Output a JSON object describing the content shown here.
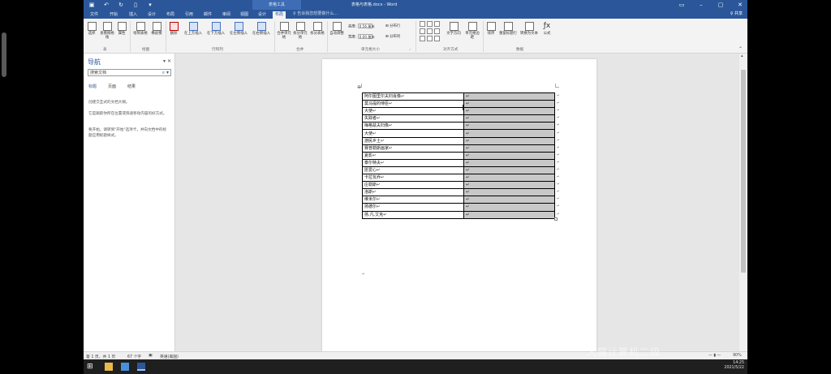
{
  "titlebar": {
    "context_tools": "表格工具",
    "doc_title": "表格与表格.docx - Word",
    "qat_icons": [
      "save-icon",
      "undo-icon",
      "redo-icon",
      "new-doc-icon",
      "customize-icon"
    ]
  },
  "tabs": [
    "文件",
    "开始",
    "插入",
    "设计",
    "布局",
    "引用",
    "邮件",
    "审阅",
    "视图",
    "设计",
    "布局"
  ],
  "active_tab_index": 10,
  "tellme": "♀ 告诉我您想要做什么...",
  "share": "♀ 共享",
  "ribbon": {
    "buttons": {
      "select": "选择",
      "gridlines": "查看网格线",
      "properties": "属性",
      "draw_table": "绘制表格",
      "eraser": "橡皮擦",
      "delete": "删除",
      "insert_above": "在上方插入",
      "insert_below": "在下方插入",
      "insert_left": "在左侧插入",
      "insert_right": "在右侧插入",
      "merge_cells": "合并单元格",
      "split_cells": "拆分单元格",
      "split_table": "拆分表格",
      "autofit": "自动调整",
      "text_direction": "文字方向",
      "cell_margins": "单元格边距",
      "sort": "排序",
      "repeat_header": "重复标题行",
      "to_text": "转换为文本",
      "formula": "公式"
    },
    "height_label": "高度:",
    "height_value": "0.56 厘米",
    "width_label": "宽度:",
    "width_value": "0.00 厘米",
    "distribute_rows": "分布行",
    "distribute_cols": "分布列",
    "groups": {
      "table": "表",
      "draw": "绘图",
      "rows_cols": "行和列",
      "merge": "合并",
      "cell_size": "单元格大小",
      "alignment": "对齐方式",
      "data": "数据"
    }
  },
  "nav": {
    "title": "导航",
    "search_value": "搜索文档",
    "tabs": [
      "标题",
      "页面",
      "结果"
    ],
    "msg1": "创建交互式的文档大纲。",
    "msg2": "它是跟踪你所在位置或快速移动内容的好方式。",
    "msg3": "要开始，请转到\"开始\"选项卡，并向文档中的标题应用标题样式。"
  },
  "table_rows": [
    "阿尔图里尔夫妇肖像↵",
    "莫马提的侍臣↵",
    "大使↵",
    "失踪者↵",
    "梅格兹夫妇像↵",
    "大使↵",
    "游民乡土↵",
    "赛普勒斯画家↵",
    "夏影↵",
    "泰尔特夫↵",
    "愿爱心↵",
    "卡拉瓦乔↵",
    "庄勒斯↵",
    "洛斯↵",
    "维米尔↵",
    "扬德尔↵",
    "扬.凡.艾克↵"
  ],
  "cell_mark": "↵",
  "status": {
    "page": "第 1 页，共 1 页",
    "words": "67 个字",
    "lang": "英语(美国)",
    "zoom": "90%"
  },
  "taskbar": {
    "time": "14:25",
    "date": "2021/5/22"
  },
  "watermark": "大猫计算机二级"
}
